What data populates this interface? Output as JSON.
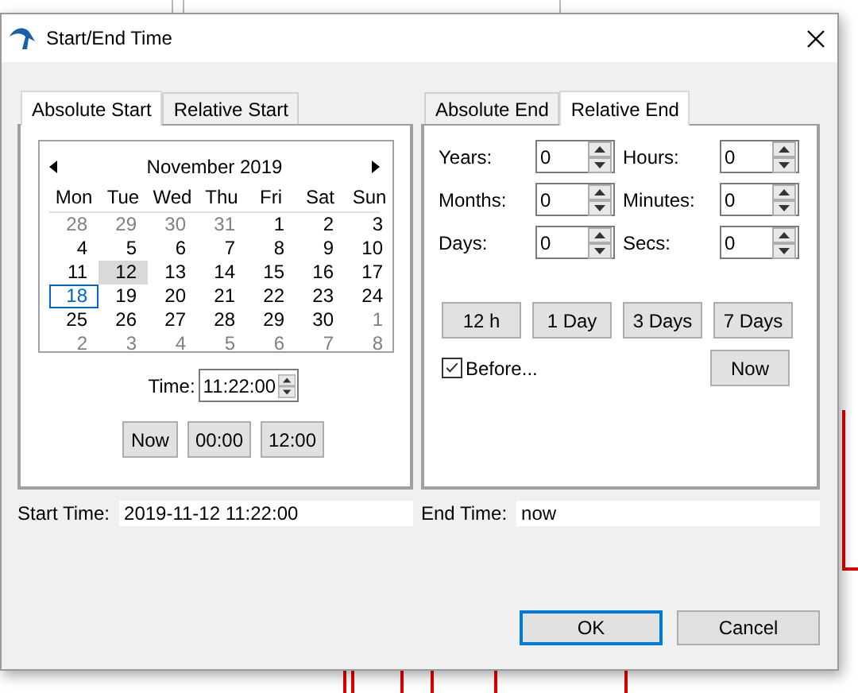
{
  "window": {
    "title": "Start/End Time"
  },
  "start_panel": {
    "tabs": [
      {
        "label": "Absolute Start",
        "selected": true
      },
      {
        "label": "Relative Start",
        "selected": false
      }
    ],
    "calendar": {
      "month": "November 2019",
      "weekdays": [
        "Mon",
        "Tue",
        "Wed",
        "Thu",
        "Fri",
        "Sat",
        "Sun"
      ],
      "weeks": [
        {
          "days": [
            {
              "day": "28",
              "other_month": true,
              "selected": false,
              "today": false
            },
            {
              "day": "29",
              "other_month": true,
              "selected": false,
              "today": false
            },
            {
              "day": "30",
              "other_month": true,
              "selected": false,
              "today": false
            },
            {
              "day": "31",
              "other_month": true,
              "selected": false,
              "today": false
            },
            {
              "day": "1",
              "other_month": false,
              "selected": false,
              "today": false
            },
            {
              "day": "2",
              "other_month": false,
              "selected": false,
              "today": false
            },
            {
              "day": "3",
              "other_month": false,
              "selected": false,
              "today": false
            }
          ]
        },
        {
          "days": [
            {
              "day": "4",
              "other_month": false,
              "selected": false,
              "today": false
            },
            {
              "day": "5",
              "other_month": false,
              "selected": false,
              "today": false
            },
            {
              "day": "6",
              "other_month": false,
              "selected": false,
              "today": false
            },
            {
              "day": "7",
              "other_month": false,
              "selected": false,
              "today": false
            },
            {
              "day": "8",
              "other_month": false,
              "selected": false,
              "today": false
            },
            {
              "day": "9",
              "other_month": false,
              "selected": false,
              "today": false
            },
            {
              "day": "10",
              "other_month": false,
              "selected": false,
              "today": false
            }
          ]
        },
        {
          "days": [
            {
              "day": "11",
              "other_month": false,
              "selected": false,
              "today": false
            },
            {
              "day": "12",
              "other_month": false,
              "selected": true,
              "today": false
            },
            {
              "day": "13",
              "other_month": false,
              "selected": false,
              "today": false
            },
            {
              "day": "14",
              "other_month": false,
              "selected": false,
              "today": false
            },
            {
              "day": "15",
              "other_month": false,
              "selected": false,
              "today": false
            },
            {
              "day": "16",
              "other_month": false,
              "selected": false,
              "today": false
            },
            {
              "day": "17",
              "other_month": false,
              "selected": false,
              "today": false
            }
          ]
        },
        {
          "days": [
            {
              "day": "18",
              "other_month": false,
              "selected": false,
              "today": true
            },
            {
              "day": "19",
              "other_month": false,
              "selected": false,
              "today": false
            },
            {
              "day": "20",
              "other_month": false,
              "selected": false,
              "today": false
            },
            {
              "day": "21",
              "other_month": false,
              "selected": false,
              "today": false
            },
            {
              "day": "22",
              "other_month": false,
              "selected": false,
              "today": false
            },
            {
              "day": "23",
              "other_month": false,
              "selected": false,
              "today": false
            },
            {
              "day": "24",
              "other_month": false,
              "selected": false,
              "today": false
            }
          ]
        },
        {
          "days": [
            {
              "day": "25",
              "other_month": false,
              "selected": false,
              "today": false
            },
            {
              "day": "26",
              "other_month": false,
              "selected": false,
              "today": false
            },
            {
              "day": "27",
              "other_month": false,
              "selected": false,
              "today": false
            },
            {
              "day": "28",
              "other_month": false,
              "selected": false,
              "today": false
            },
            {
              "day": "29",
              "other_month": false,
              "selected": false,
              "today": false
            },
            {
              "day": "30",
              "other_month": false,
              "selected": false,
              "today": false
            },
            {
              "day": "1",
              "other_month": true,
              "selected": false,
              "today": false
            }
          ]
        },
        {
          "days": [
            {
              "day": "2",
              "other_month": true,
              "selected": false,
              "today": false
            },
            {
              "day": "3",
              "other_month": true,
              "selected": false,
              "today": false
            },
            {
              "day": "4",
              "other_month": true,
              "selected": false,
              "today": false
            },
            {
              "day": "5",
              "other_month": true,
              "selected": false,
              "today": false
            },
            {
              "day": "6",
              "other_month": true,
              "selected": false,
              "today": false
            },
            {
              "day": "7",
              "other_month": true,
              "selected": false,
              "today": false
            },
            {
              "day": "8",
              "other_month": true,
              "selected": false,
              "today": false
            }
          ]
        }
      ]
    },
    "time": {
      "label": "Time:",
      "value": "11:22:00"
    },
    "buttons": [
      "Now",
      "00:00",
      "12:00"
    ]
  },
  "end_panel": {
    "tabs": [
      {
        "label": "Absolute End",
        "selected": false
      },
      {
        "label": "Relative End",
        "selected": true
      }
    ],
    "fields": [
      {
        "label": "Years:",
        "value": "0"
      },
      {
        "label": "Hours:",
        "value": "0"
      },
      {
        "label": "Months:",
        "value": "0"
      },
      {
        "label": "Minutes:",
        "value": "0"
      },
      {
        "label": "Days:",
        "value": "0"
      },
      {
        "label": "Secs:",
        "value": "0"
      }
    ],
    "presets": [
      "12 h",
      "1 Day",
      "3 Days",
      "7 Days"
    ],
    "before": {
      "label": "Before...",
      "checked": true
    },
    "now_button": "Now"
  },
  "summary": [
    {
      "label": "Start Time:",
      "value": "2019-11-12 11:22:00"
    },
    {
      "label": "End Time:",
      "value": "now"
    }
  ],
  "footer_buttons": [
    {
      "label": "OK",
      "default": true
    },
    {
      "label": "Cancel",
      "default": false
    }
  ]
}
